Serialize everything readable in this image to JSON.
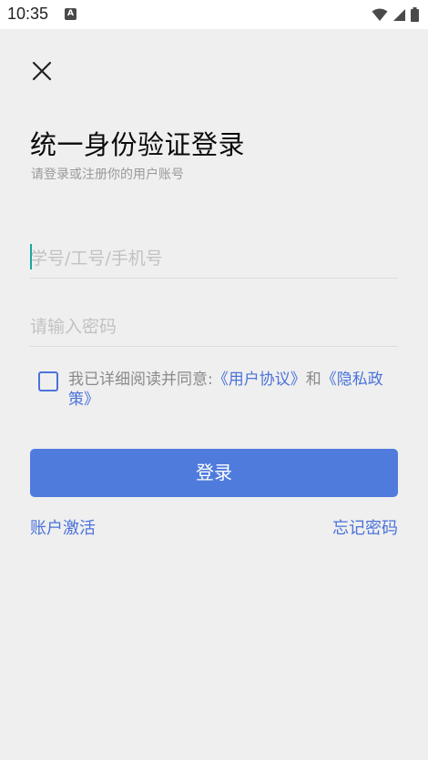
{
  "status_bar": {
    "time": "10:35",
    "notification_glyph": "A",
    "icons": [
      "wifi-icon",
      "signal-icon",
      "battery-icon"
    ]
  },
  "header": {
    "close_icon": "close-icon"
  },
  "login": {
    "title": "统一身份验证登录",
    "subtitle": "请登录或注册你的用户账号",
    "account_placeholder": "学号/工号/手机号",
    "password_placeholder": "请输入密码",
    "agreement": {
      "prefix": "我已详细阅读并同意:",
      "user_agreement": "《用户协议》",
      "conjunction": "和",
      "privacy_policy": "《隐私政策》"
    },
    "submit_label": "登录",
    "activate_label": "账户激活",
    "forgot_label": "忘记密码"
  },
  "colors": {
    "accent": "#4f7bdd",
    "link": "#4b73d8",
    "background": "#efeff0",
    "caret": "#1aa89a"
  }
}
